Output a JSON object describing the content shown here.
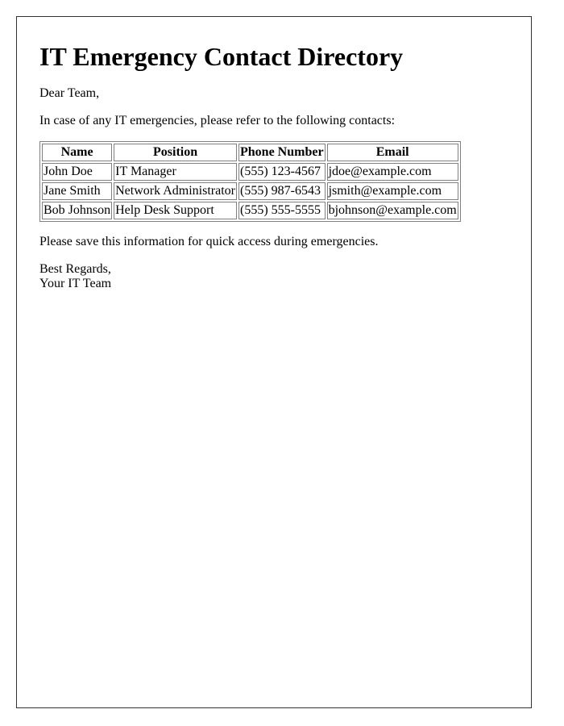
{
  "document": {
    "title": "IT Emergency Contact Directory",
    "greeting": "Dear Team,",
    "intro": "In case of any IT emergencies, please refer to the following contacts:",
    "table": {
      "headers": [
        "Name",
        "Position",
        "Phone Number",
        "Email"
      ],
      "rows": [
        [
          "John Doe",
          "IT Manager",
          "(555) 123-4567",
          "jdoe@example.com"
        ],
        [
          "Jane Smith",
          "Network Administrator",
          "(555) 987-6543",
          "jsmith@example.com"
        ],
        [
          "Bob Johnson",
          "Help Desk Support",
          "(555) 555-5555",
          "bjohnson@example.com"
        ]
      ]
    },
    "closing_note": "Please save this information for quick access during emergencies.",
    "signoff_line1": "Best Regards,",
    "signoff_line2": "Your IT Team"
  }
}
